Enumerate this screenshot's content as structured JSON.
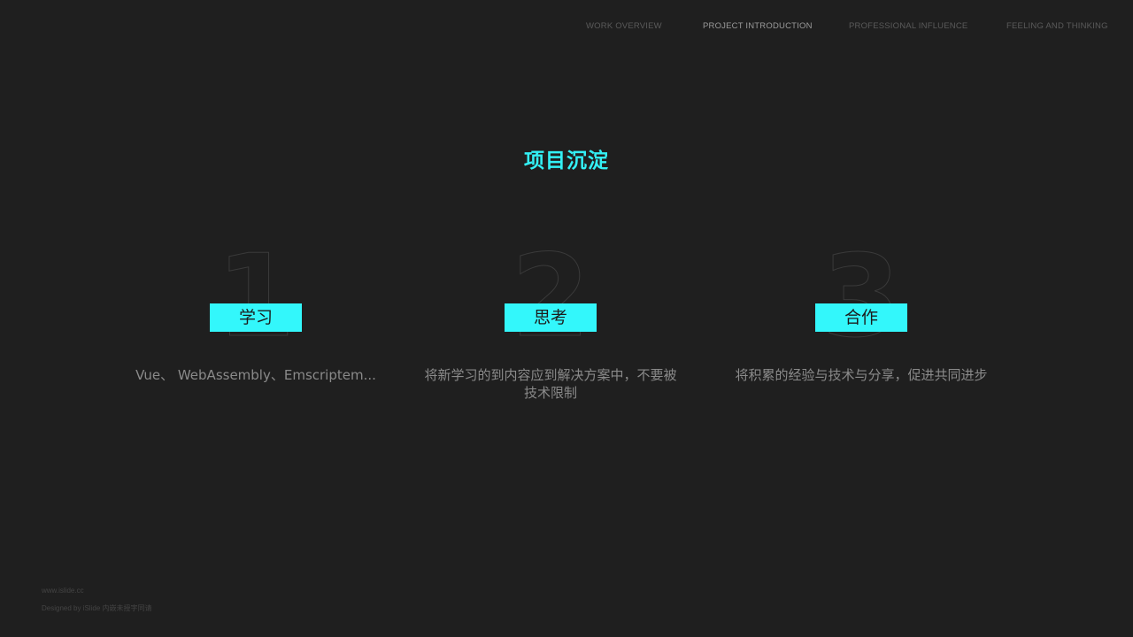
{
  "nav": {
    "items": [
      {
        "label": "WORK OVERVIEW",
        "active": false
      },
      {
        "label": "PROJECT INTRODUCTION",
        "active": true
      },
      {
        "label": "PROFESSIONAL INFLUENCE",
        "active": false
      },
      {
        "label": "FEELING AND THINKING",
        "active": false
      }
    ]
  },
  "title": "项目沉淀",
  "cards": [
    {
      "number": "1",
      "label": "学习",
      "description": "Vue、 WebAssembly、Emscriptem..."
    },
    {
      "number": "2",
      "label": "思考",
      "description": "将新学习的到内容应到解决方案中，不要被技术限制"
    },
    {
      "number": "3",
      "label": "合作",
      "description": "将积累的经验与技术与分享，促进共同进步"
    }
  ],
  "footer": {
    "url": "www.islide.cc",
    "credit": "Designed by iSlide 内嵌未授字同请"
  },
  "colors": {
    "background": "#1f1f1f",
    "accent": "#33f7fb",
    "title": "#33f0f5"
  }
}
